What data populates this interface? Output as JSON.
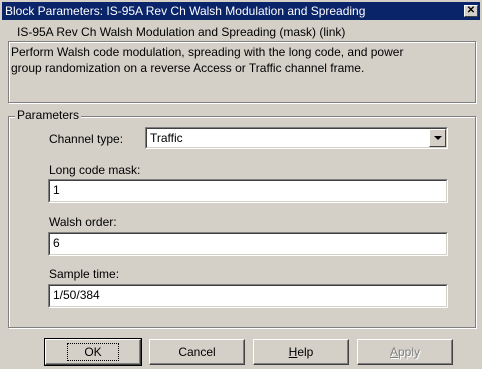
{
  "window": {
    "title": "Block Parameters: IS-95A Rev Ch Walsh Modulation and Spreading"
  },
  "mask_group": {
    "label": "IS-95A Rev Ch Walsh Modulation and Spreading (mask) (link)",
    "description": "Perform Walsh code modulation, spreading with the long code, and power\ngroup randomization on a reverse Access or Traffic channel frame."
  },
  "parameters": {
    "label": "Parameters",
    "channel_type": {
      "label": "Channel type:",
      "value": "Traffic"
    },
    "long_code_mask": {
      "label": "Long code mask:",
      "value": "1"
    },
    "walsh_order": {
      "label": "Walsh order:",
      "value": "6"
    },
    "sample_time": {
      "label": "Sample time:",
      "value": "1/50/384"
    }
  },
  "buttons": {
    "ok": "OK",
    "cancel": "Cancel",
    "help_prefix": "",
    "help_mnemonic": "H",
    "help_rest": "elp",
    "apply_mnemonic": "A",
    "apply_rest": "pply"
  },
  "icons": {
    "close": "close-icon",
    "dropdown": "chevron-down-icon"
  },
  "colors": {
    "titlebar": "#0a246a",
    "face": "#d4d0c8"
  }
}
